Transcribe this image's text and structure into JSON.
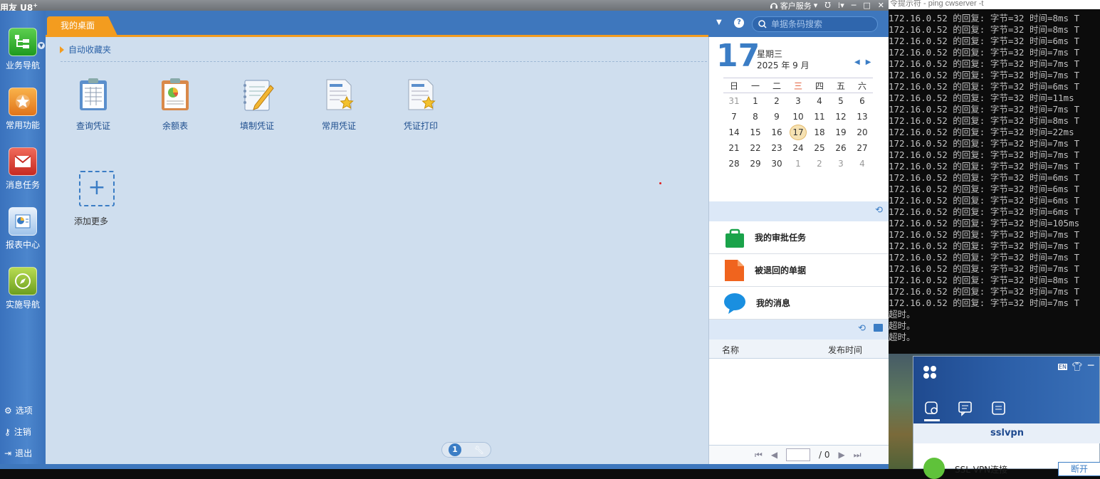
{
  "app": {
    "logo": "用友 U8",
    "logo_sup": "+",
    "customer_service": "客户服务",
    "window_controls": [
      "help-icon",
      "more-icon",
      "minimize-icon",
      "maximize-icon",
      "close-icon"
    ]
  },
  "sidebar": {
    "items": [
      {
        "label": "业务导航",
        "icon": "business-nav-icon",
        "color": "#2fa92f"
      },
      {
        "label": "常用功能",
        "icon": "star-icon",
        "color": "#e88a1a"
      },
      {
        "label": "消息任务",
        "icon": "message-icon",
        "color": "#d93a2e"
      },
      {
        "label": "报表中心",
        "icon": "report-icon",
        "color": "#3b7dc5"
      },
      {
        "label": "实施导航",
        "icon": "compass-icon",
        "color": "#7fae2a"
      }
    ],
    "bottom": [
      {
        "label": "选项",
        "icon": "gear-icon"
      },
      {
        "label": "注销",
        "icon": "key-icon"
      },
      {
        "label": "退出",
        "icon": "exit-icon"
      }
    ]
  },
  "tab": {
    "label": "我的桌面"
  },
  "favorites": {
    "title": "自动收藏夹",
    "apps": [
      {
        "label": "查询凭证",
        "icon": "query-voucher-icon"
      },
      {
        "label": "余额表",
        "icon": "balance-sheet-icon"
      },
      {
        "label": "填制凭证",
        "icon": "fill-voucher-icon"
      },
      {
        "label": "常用凭证",
        "icon": "common-voucher-icon"
      },
      {
        "label": "凭证打印",
        "icon": "print-voucher-icon"
      }
    ],
    "add_more": "添加更多"
  },
  "pager": {
    "page": "1"
  },
  "search": {
    "placeholder": "单据条码搜索"
  },
  "calendar": {
    "day": "17",
    "weekday": "星期三",
    "month": "2025 年 9 月",
    "week_headers": [
      "日",
      "一",
      "二",
      "三",
      "四",
      "五",
      "六"
    ],
    "highlight_header": "三",
    "weeks": [
      [
        "31",
        "1",
        "2",
        "3",
        "4",
        "5",
        "6"
      ],
      [
        "7",
        "8",
        "9",
        "10",
        "11",
        "12",
        "13"
      ],
      [
        "14",
        "15",
        "16",
        "17",
        "18",
        "19",
        "20"
      ],
      [
        "21",
        "22",
        "23",
        "24",
        "25",
        "26",
        "27"
      ],
      [
        "28",
        "29",
        "30",
        "1",
        "2",
        "3",
        "4"
      ]
    ],
    "today": "17"
  },
  "tasks": [
    {
      "label": "我的审批任务",
      "icon": "approval-bag-icon",
      "color": "#1aa34a"
    },
    {
      "label": "被退回的单据",
      "icon": "returned-doc-icon",
      "color": "#f0641e"
    },
    {
      "label": "我的消息",
      "icon": "chat-bubble-icon",
      "color": "#1a8fe0"
    }
  ],
  "news_table": {
    "col_name": "名称",
    "col_time": "发布时间",
    "page_total": "/ 0"
  },
  "console": {
    "title": "令提示符 - ping cwserver -t",
    "lines": [
      "172.16.0.52 的回复: 字节=32 时间=8ms T",
      "172.16.0.52 的回复: 字节=32 时间=8ms T",
      "172.16.0.52 的回复: 字节=32 时间=6ms T",
      "172.16.0.52 的回复: 字节=32 时间=7ms T",
      "172.16.0.52 的回复: 字节=32 时间=7ms T",
      "172.16.0.52 的回复: 字节=32 时间=7ms T",
      "172.16.0.52 的回复: 字节=32 时间=6ms T",
      "172.16.0.52 的回复: 字节=32 时间=11ms",
      "172.16.0.52 的回复: 字节=32 时间=7ms T",
      "172.16.0.52 的回复: 字节=32 时间=8ms T",
      "172.16.0.52 的回复: 字节=32 时间=22ms",
      "172.16.0.52 的回复: 字节=32 时间=7ms T",
      "172.16.0.52 的回复: 字节=32 时间=7ms T",
      "172.16.0.52 的回复: 字节=32 时间=7ms T",
      "172.16.0.52 的回复: 字节=32 时间=6ms T",
      "172.16.0.52 的回复: 字节=32 时间=6ms T",
      "172.16.0.52 的回复: 字节=32 时间=6ms T",
      "172.16.0.52 的回复: 字节=32 时间=6ms T",
      "172.16.0.52 的回复: 字节=32 时间=105ms",
      "172.16.0.52 的回复: 字节=32 时间=7ms T",
      "172.16.0.52 的回复: 字节=32 时间=7ms T",
      "172.16.0.52 的回复: 字节=32 时间=7ms T",
      "172.16.0.52 的回复: 字节=32 时间=7ms T",
      "172.16.0.52 的回复: 字节=32 时间=8ms T",
      "172.16.0.52 的回复: 字节=32 时间=7ms T",
      "172.16.0.52 的回复: 字节=32 时间=7ms T",
      "超时。",
      "超时。",
      "超时。"
    ]
  },
  "vpn": {
    "label": "sslvpn",
    "lang": "EN",
    "connection": "SSL VPN连接",
    "disconnect": "断开"
  }
}
